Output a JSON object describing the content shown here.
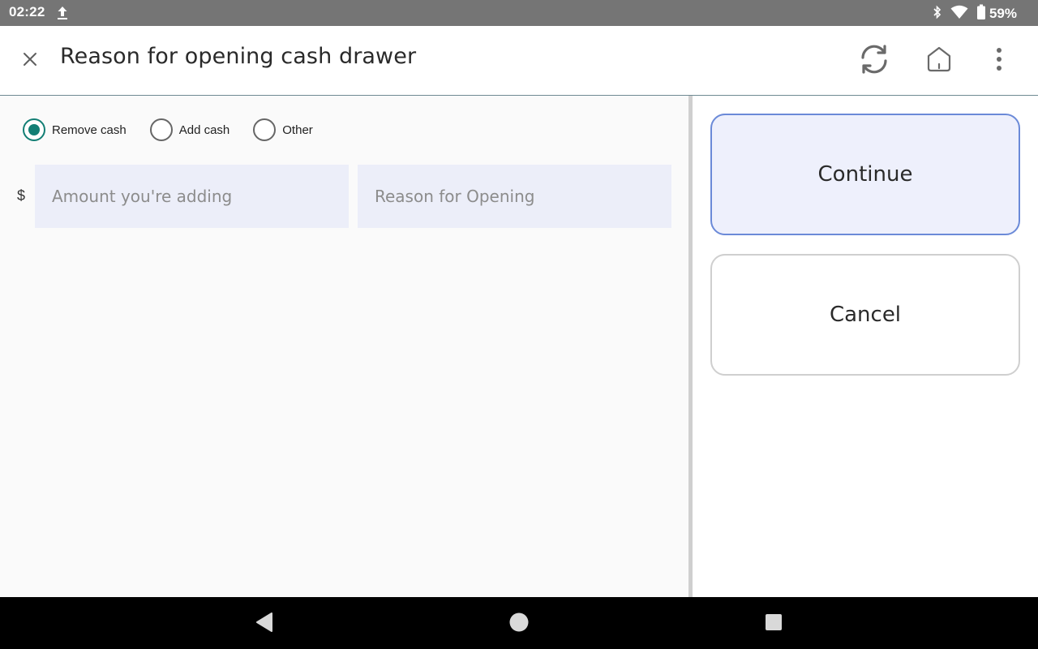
{
  "status_bar": {
    "time": "02:22",
    "battery": "59%",
    "icons": [
      "upload-icon",
      "bluetooth-icon",
      "wifi-icon",
      "battery-icon"
    ]
  },
  "app_bar": {
    "title": "Reason for opening cash drawer",
    "icons": [
      "close-icon",
      "sync-icon",
      "home-icon",
      "more-vert-icon"
    ]
  },
  "form": {
    "options": [
      {
        "label": "Remove cash",
        "checked": true
      },
      {
        "label": "Add cash",
        "checked": false
      },
      {
        "label": "Other",
        "checked": false
      }
    ],
    "currency_symbol": "$",
    "amount_placeholder": "Amount you're adding",
    "reason_placeholder": "Reason for Opening"
  },
  "actions": {
    "continue_label": "Continue",
    "cancel_label": "Cancel"
  },
  "colors": {
    "accent": "#127e74",
    "continue_border": "#6b8ad8",
    "continue_bg": "#eef0fc",
    "field_bg": "#eceef9",
    "status_bar": "#757575"
  }
}
